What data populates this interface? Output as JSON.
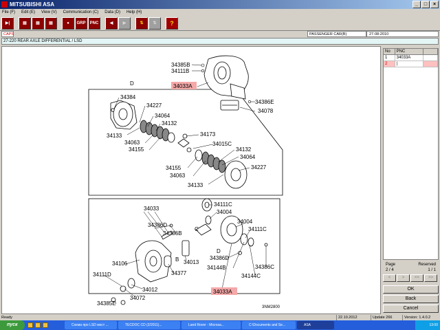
{
  "window": {
    "title": "MITSUBISHI ASA",
    "controls": [
      "_",
      "□",
      "×"
    ]
  },
  "menu": [
    "File (F)",
    "Edit (E)",
    "View (V)",
    "Communication (C)",
    "Data (D)",
    "Help (H)"
  ],
  "toolbar": {
    "exit": "▶|",
    "print1": "▤",
    "print2": "▤",
    "preview": "▤",
    "save": "●",
    "grp": "GRP",
    "pnc": "PNC",
    "prev": "◀",
    "next": "▶",
    "transfer": "⇅",
    "clip": "⇅",
    "help": "?"
  },
  "info": {
    "caps": "CAPS",
    "vehicle": "PASSENGER CAR(B)",
    "date": "27-08-2010"
  },
  "group": "27-220  REAR AXLE DIFFERENTIAL / LSD",
  "diagram": {
    "section_d": "D",
    "section_b": "B",
    "section_c": "C",
    "section_d2": "D",
    "code": "3NM2800",
    "labels": {
      "l34385b": "34385B",
      "l34111b": "34111B",
      "l34033a1": "34033A",
      "l34386e": "34386E",
      "l34078": "34078",
      "l34384": "34384",
      "l34227a": "34227",
      "l34064a": "34064",
      "l34132a": "34132",
      "l34133a": "34133",
      "l34063a": "34063",
      "l34155a": "34155",
      "l34173": "34173",
      "l34015c": "34015C",
      "l34132b": "34132",
      "l34064b": "34064",
      "l34155b": "34155",
      "l34227b": "34227",
      "l34063b": "34063",
      "l34133b": "34133",
      "l34033": "34033",
      "l34386d1": "34386D",
      "l34386b": "34386B",
      "l34111c1": "34111C",
      "l34004a": "34004",
      "l34004b": "34004",
      "l34111c2": "34111C",
      "l34013": "34013",
      "l34386d2": "34386D",
      "l34106": "34106",
      "l34377": "34377",
      "l34144b": "34144B",
      "l34386c": "34386C",
      "l34144c": "34144C",
      "l34111d": "34111D",
      "l34012": "34012",
      "l34072": "34072",
      "l34385e": "34385E",
      "l34033a2": "34033A"
    }
  },
  "pnc_table": {
    "headers": [
      "No",
      "PNC",
      ""
    ],
    "rows": [
      {
        "no": "1",
        "pnc": "34033A"
      },
      {
        "no": "2",
        "pnc": "|"
      }
    ]
  },
  "pager": {
    "page_label": "Page",
    "page_value": "2 / 4",
    "reserved_label": "Reserved",
    "reserved_value": "1 / 1",
    "btns": [
      "<",
      ">",
      "<<",
      ">>"
    ]
  },
  "actions": {
    "ok": "OK",
    "back": "Back",
    "cancel": "Cancel"
  },
  "status": {
    "left": "Ready",
    "date": "22.10.2012",
    "update": "Update 266",
    "version": "Version: 1.4.0.2"
  },
  "taskbar": {
    "start": "пуск",
    "tasks": [
      "Схема про LSD мост ...",
      "TECDOC CD (2/2011)...",
      "Land Rover - Microsa...",
      "C:\\Documents and Se...",
      "ASA"
    ],
    "tray": "13:00"
  }
}
